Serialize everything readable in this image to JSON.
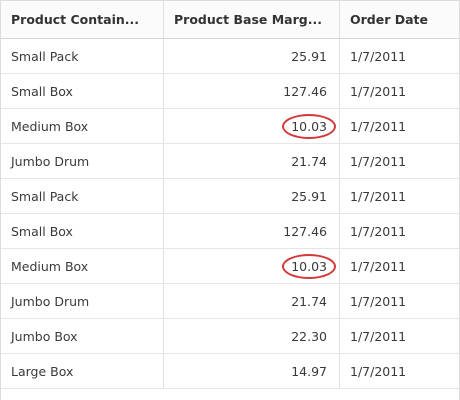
{
  "columns": [
    "Product Contain...",
    "Product Base Marg...",
    "Order Date"
  ],
  "rows": [
    {
      "container": "Small Pack",
      "margin": "25.91",
      "date": "1/7/2011",
      "highlighted": false
    },
    {
      "container": "Small Box",
      "margin": "127.46",
      "date": "1/7/2011",
      "highlighted": false
    },
    {
      "container": "Medium Box",
      "margin": "10.03",
      "date": "1/7/2011",
      "highlighted": true
    },
    {
      "container": "Jumbo Drum",
      "margin": "21.74",
      "date": "1/7/2011",
      "highlighted": false
    },
    {
      "container": "Small Pack",
      "margin": "25.91",
      "date": "1/7/2011",
      "highlighted": false
    },
    {
      "container": "Small Box",
      "margin": "127.46",
      "date": "1/7/2011",
      "highlighted": false
    },
    {
      "container": "Medium Box",
      "margin": "10.03",
      "date": "1/7/2011",
      "highlighted": true
    },
    {
      "container": "Jumbo Drum",
      "margin": "21.74",
      "date": "1/7/2011",
      "highlighted": false
    },
    {
      "container": "Jumbo Box",
      "margin": "22.30",
      "date": "1/7/2011",
      "highlighted": false
    },
    {
      "container": "Large Box",
      "margin": "14.97",
      "date": "1/7/2011",
      "highlighted": false
    }
  ],
  "colors": {
    "highlight_ring": "#d23a3a"
  }
}
